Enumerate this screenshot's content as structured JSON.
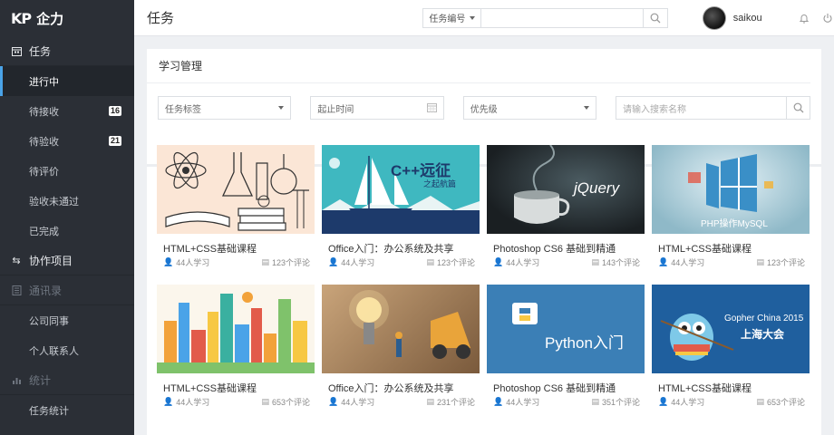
{
  "app": {
    "logo_mark": "KP",
    "logo_text": "企力"
  },
  "sidebar": {
    "sections": [
      {
        "label": "任务",
        "icon": "calendar-icon"
      },
      {
        "label": "协作项目",
        "icon": "swap-icon"
      },
      {
        "label": "通讯录",
        "icon": "contacts-icon"
      },
      {
        "label": "统计",
        "icon": "bar-chart-icon"
      }
    ],
    "task_items": [
      {
        "label": "进行中",
        "badge": ""
      },
      {
        "label": "待接收",
        "badge": "16"
      },
      {
        "label": "待验收",
        "badge": "21"
      },
      {
        "label": "待评价",
        "badge": ""
      },
      {
        "label": "验收未通过",
        "badge": ""
      },
      {
        "label": "已完成",
        "badge": ""
      }
    ],
    "contacts_items": [
      {
        "label": "公司同事"
      },
      {
        "label": "个人联系人"
      }
    ],
    "stats_items": [
      {
        "label": "任务统计"
      }
    ]
  },
  "header": {
    "title": "任务",
    "search_select": "任务编号",
    "search_placeholder": "",
    "username": "saikou"
  },
  "panel": {
    "title": "学习管理",
    "filters": {
      "tag": "任务标签",
      "date": "起止时间",
      "priority": "优先级",
      "search_placeholder": "请输入搜索名称"
    }
  },
  "courses": [
    {
      "title": "HTML+CSS基础课程",
      "learners": "44人学习",
      "comments": "123个评论",
      "thumb_text": ""
    },
    {
      "title": "Office入门：办公系统及共享",
      "learners": "44人学习",
      "comments": "123个评论",
      "thumb_text": "C++远征",
      "thumb_sub": "之起航篇"
    },
    {
      "title": "Photoshop CS6 基础到精通",
      "learners": "44人学习",
      "comments": "143个评论",
      "thumb_text": "jQuery"
    },
    {
      "title": "HTML+CSS基础课程",
      "learners": "44人学习",
      "comments": "123个评论",
      "thumb_text": "PHP操作MySQL"
    },
    {
      "title": "HTML+CSS基础课程",
      "learners": "44人学习",
      "comments": "653个评论",
      "thumb_text": ""
    },
    {
      "title": "Office入门：办公系统及共享",
      "learners": "44人学习",
      "comments": "231个评论",
      "thumb_text": ""
    },
    {
      "title": "Photoshop CS6 基础到精通",
      "learners": "44人学习",
      "comments": "351个评论",
      "thumb_text": "Python入门"
    },
    {
      "title": "HTML+CSS基础课程",
      "learners": "44人学习",
      "comments": "653个评论",
      "thumb_text": "Gopher China 2015",
      "thumb_sub": "上海大会"
    }
  ],
  "colors": {
    "sidebar_bg": "#2b2f36",
    "accent": "#4aa3e8"
  }
}
